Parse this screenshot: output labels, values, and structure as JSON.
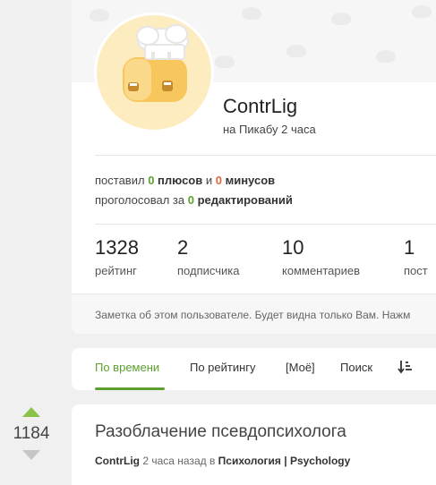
{
  "profile": {
    "name": "ContrLig",
    "since": "на Пикабу 2 часа"
  },
  "activity": {
    "line1": {
      "p1": "поставил ",
      "plus_count": "0",
      "p2": " плюсов",
      "p3": " и ",
      "minus_count": "0",
      "p4": " минусов"
    },
    "line2": {
      "p1": "проголосовал за ",
      "edits_count": "0",
      "p2": " редактирований"
    }
  },
  "metrics": [
    {
      "value": "1328",
      "label": "рейтинг"
    },
    {
      "value": "2",
      "label": "подписчика"
    },
    {
      "value": "10",
      "label": "комментариев"
    },
    {
      "value": "1",
      "label": "пост"
    }
  ],
  "note": {
    "text": "Заметка об этом пользователе. Будет видна только Вам. Нажм"
  },
  "tabs": [
    {
      "label": "По времени",
      "active": true
    },
    {
      "label": "По рейтингу"
    },
    {
      "label": "[Моё]"
    },
    {
      "label": "Поиск"
    }
  ],
  "post": {
    "title": "Разоблачение псевдопсихолога",
    "author": "ContrLig",
    "time": " 2 часа назад в ",
    "community": "Психология | Psychology",
    "rating": "1184"
  },
  "colors": {
    "accent_green": "#5da02f",
    "minus_red": "#e0663f",
    "vote_up": "#8bc34a"
  }
}
